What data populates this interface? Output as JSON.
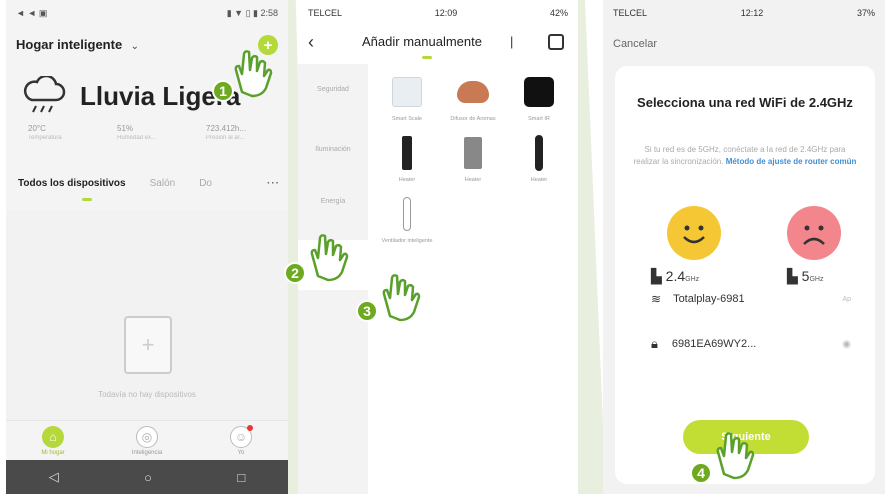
{
  "phone1": {
    "status": {
      "left": "◄ ◄ ▣",
      "right": "▮ ▼ ▯ ▮ 2:58"
    },
    "home_title": "Hogar inteligente",
    "weather": {
      "condition": "Lluvia Ligera",
      "stats": [
        {
          "value": "20°C",
          "label": "Temperatura"
        },
        {
          "value": "51%",
          "label": "Humedad ex..."
        },
        {
          "value": "723.412h...",
          "label": "Presión al ar..."
        }
      ]
    },
    "tabs": [
      "Todos los dispositivos",
      "Salón",
      "Do"
    ],
    "more": "···",
    "empty_text": "Todavía no hay dispositivos",
    "tabbar": [
      {
        "label": "Mi hogar"
      },
      {
        "label": "Inteligencia"
      },
      {
        "label": "Yo"
      }
    ],
    "android_nav": [
      "◁",
      "○",
      "□"
    ]
  },
  "phone2": {
    "status": {
      "carrier": "TELCEL",
      "time": "12:09",
      "battery": "42%"
    },
    "title": "Añadir manualmente",
    "categories": [
      "Seguridad",
      "Iluminación",
      "Energía",
      ""
    ],
    "devices": [
      "Smart Scale",
      "Difusor de Aromas",
      "Smart IR",
      "Heater",
      "Heater",
      "Heater",
      "Ventilador inteligente"
    ]
  },
  "phone3": {
    "status": {
      "carrier": "TELCEL",
      "time": "12:12",
      "battery": "37%"
    },
    "cancel": "Cancelar",
    "title": "Selecciona una red WiFi de 2.4GHz",
    "desc": "Si tu red es de 5GHz, conéctate a la red de 2.4GHz para realizar la sincronización.",
    "link": "Método de ajuste de router común",
    "freq_24": "2.4",
    "freq_5": "5",
    "freq_unit": "GHz",
    "wifi_name": "Totalplay-6981",
    "wifi_action": "Ap",
    "password": "6981EA69WY2...",
    "next": "Siguiente"
  },
  "markers": [
    "1",
    "2",
    "3",
    "4"
  ],
  "colors": {
    "accent": "#b5d83b",
    "marker": "#6eaa1f",
    "link": "#3f8fd6"
  }
}
